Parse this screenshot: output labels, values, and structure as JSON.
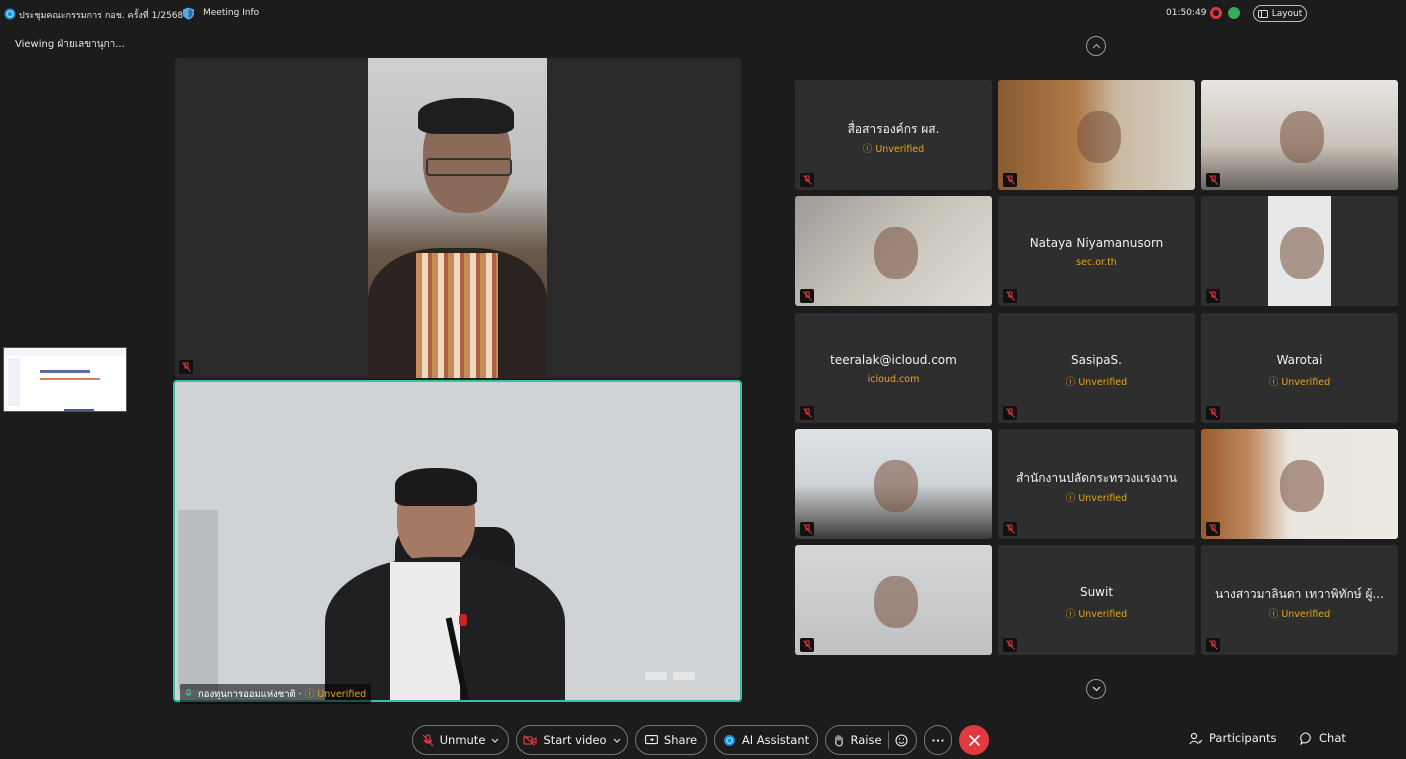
{
  "topbar": {
    "meeting_title": "ประชุมคณะกรรมการ กอช. ครั้งที่ 1/2568",
    "meeting_info_label": "Meeting Info",
    "time": "01:50:49",
    "layout_label": "Layout"
  },
  "viewing_label": "Viewing ฝ่ายเลขานุกา...",
  "main_bottom": {
    "name": "กองทุนการออมแห่งชาติ ·",
    "status": "Unverified"
  },
  "grid": [
    {
      "name": "สื่อสารองค์กร ผส.",
      "sub": "Unverified",
      "sub_kind": "unverified"
    },
    {
      "name": "",
      "sub": "",
      "video": true
    },
    {
      "name": "",
      "sub": "",
      "video": true
    },
    {
      "name": "",
      "sub": "",
      "video": true
    },
    {
      "name": "Nataya Niyamanusorn",
      "sub": "sec.or.th",
      "sub_kind": "domain"
    },
    {
      "name": "",
      "sub": "",
      "video": true
    },
    {
      "name": "teeralak@icloud.com",
      "sub": "icloud.com",
      "sub_kind": "domain"
    },
    {
      "name": "SasipaS.",
      "sub": "Unverified",
      "sub_kind": "unverified"
    },
    {
      "name": "Warotai",
      "sub": "Unverified",
      "sub_kind": "unverified"
    },
    {
      "name": "",
      "sub": "",
      "video": true
    },
    {
      "name": "สำนักงานปลัดกระทรวงแรงงาน",
      "sub": "Unverified",
      "sub_kind": "unverified"
    },
    {
      "name": "",
      "sub": "",
      "video": true
    },
    {
      "name": "",
      "sub": "",
      "video": true
    },
    {
      "name": "Suwit",
      "sub": "Unverified",
      "sub_kind": "unverified"
    },
    {
      "name": "นางสาวมาลินดา เทวาพิทักษ์ ผู้...",
      "sub": "Unverified",
      "sub_kind": "unverified"
    }
  ],
  "toolbar": {
    "unmute": "Unmute",
    "start_video": "Start video",
    "share": "Share",
    "ai_assistant": "AI Assistant",
    "raise": "Raise",
    "participants": "Participants",
    "chat": "Chat"
  },
  "colors": {
    "accent_border": "#37bfa7",
    "unverified": "#e6a417",
    "end_call": "#e0393e",
    "mute_icon": "#e0393e"
  }
}
